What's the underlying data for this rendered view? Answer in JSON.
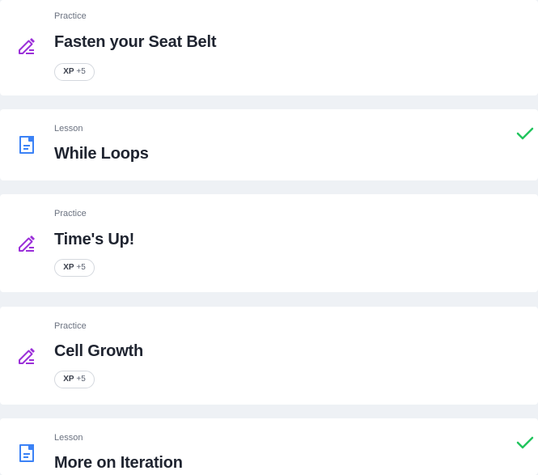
{
  "items": [
    {
      "type": "Practice",
      "title": "Fasten your Seat Belt",
      "xp_label": "XP",
      "xp_value": "+5",
      "icon": "pencil-icon",
      "completed": false
    },
    {
      "type": "Lesson",
      "title": "While Loops",
      "icon": "document-icon",
      "completed": true
    },
    {
      "type": "Practice",
      "title": "Time's Up!",
      "xp_label": "XP",
      "xp_value": "+5",
      "icon": "pencil-icon",
      "completed": false
    },
    {
      "type": "Practice",
      "title": "Cell Growth",
      "xp_label": "XP",
      "xp_value": "+5",
      "icon": "pencil-icon",
      "completed": false
    },
    {
      "type": "Lesson",
      "title": "More on Iteration",
      "icon": "document-icon",
      "completed": true
    }
  ],
  "colors": {
    "practice_icon": "#9b30d9",
    "lesson_icon": "#3b82f6",
    "check": "#22c55e",
    "background": "#eef1f5"
  }
}
